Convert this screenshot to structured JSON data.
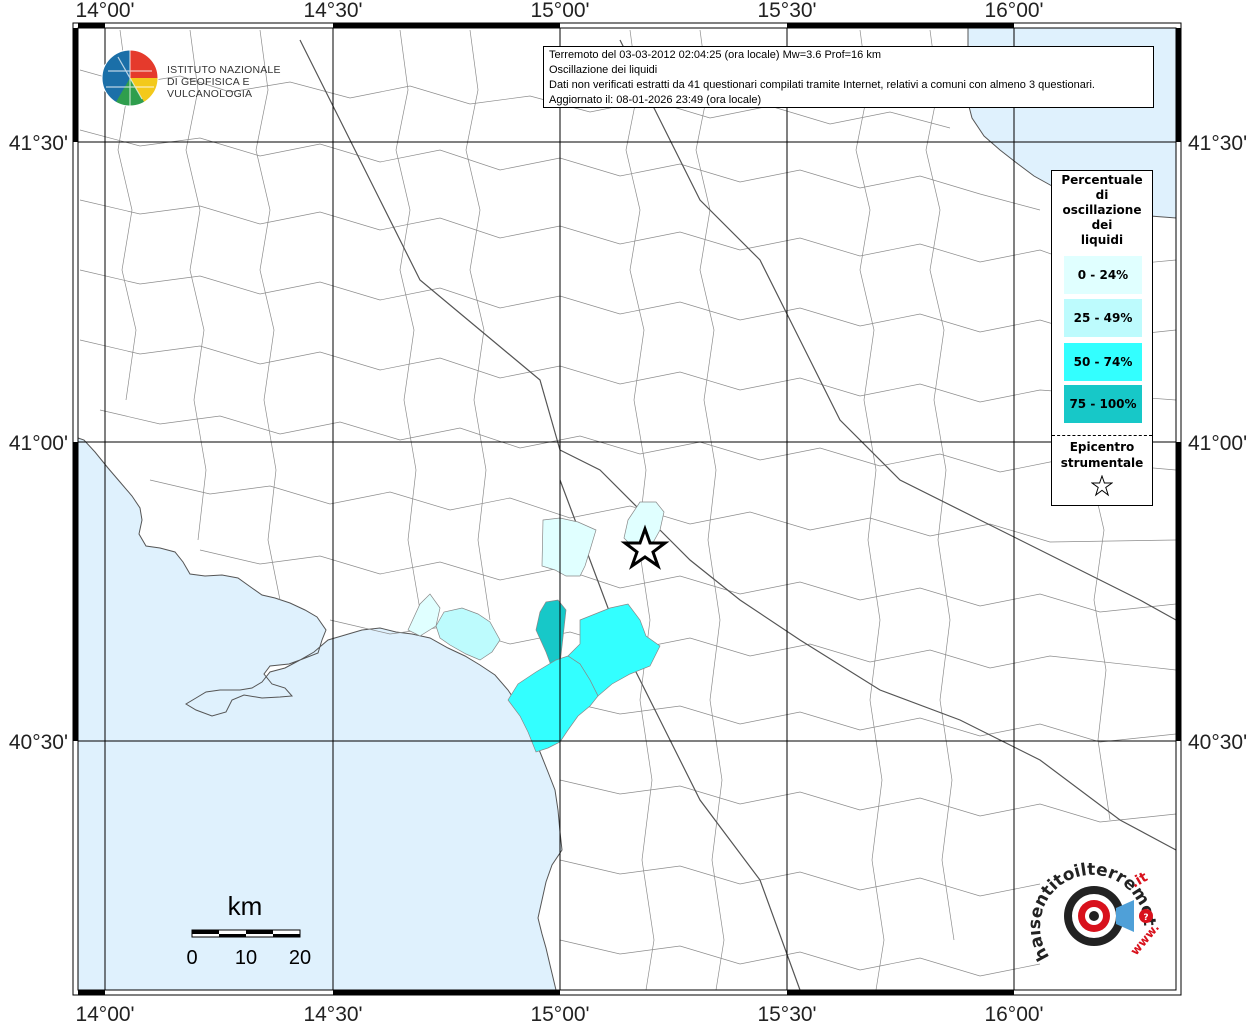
{
  "map": {
    "grid_longitudes": [
      "14°00'",
      "14°30'",
      "15°00'",
      "15°30'",
      "16°00'"
    ],
    "grid_latitudes": [
      "41°30'",
      "41°00'",
      "40°30'"
    ],
    "colors": {
      "sea": "#dff1fd",
      "land": "#ffffff",
      "border": "#8c8c8c",
      "frame": "#000000",
      "class_0_24": "#e0ffff",
      "class_25_49": "#bdfbfd",
      "class_50_74": "#33ffff",
      "class_75_100": "#17c8c8"
    }
  },
  "info": {
    "line1": "Terremoto del 03-03-2012 02:04:25 (ora locale) Mw=3.6 Prof=16 km",
    "line2": "Oscillazione dei liquidi",
    "line3": "Dati non verificati estratti da 41 questionari compilati tramite Internet, relativi a comuni con almeno 3 questionari.",
    "line4": "Aggiornato il: 08-01-2026 23:49 (ora locale)"
  },
  "ingv": {
    "line1": "ISTITUTO NAZIONALE",
    "line2": "DI GEOFISICA E VULCANOLOGIA"
  },
  "legend": {
    "title_l1": "Percentuale",
    "title_l2": "di",
    "title_l3": "oscillazione",
    "title_l4": "dei",
    "title_l5": "liquidi",
    "classes": [
      "0 - 24%",
      "25 - 49%",
      "50 - 74%",
      "75 - 100%"
    ],
    "epicenter_l1": "Epicentro",
    "epicenter_l2": "strumentale"
  },
  "scale": {
    "unit": "km",
    "ticks": [
      "0",
      "10",
      "20"
    ]
  },
  "sentito_logo": {
    "text": "www.haisentitoilterremoto.it"
  }
}
